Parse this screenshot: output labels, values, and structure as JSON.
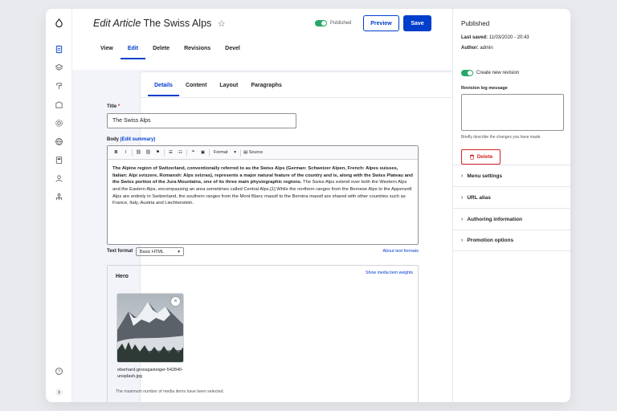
{
  "header": {
    "title_italic": "Edit Article",
    "title_name": "The Swiss Alps",
    "star_glyph": "☆",
    "published_label": "Published",
    "preview_label": "Preview",
    "save_label": "Save"
  },
  "primary_tabs": [
    {
      "label": "View"
    },
    {
      "label": "Edit"
    },
    {
      "label": "Delete"
    },
    {
      "label": "Revisions"
    },
    {
      "label": "Devel"
    }
  ],
  "secondary_tabs": [
    {
      "label": "Details"
    },
    {
      "label": "Content"
    },
    {
      "label": "Layout"
    },
    {
      "label": "Paragraphs"
    }
  ],
  "form": {
    "title_label": "Title",
    "title_required": "*",
    "title_value": "The Swiss Alps",
    "body_label": "Body",
    "body_link": "(Edit summary)",
    "toolbar": {
      "bold": "B",
      "italic": "I",
      "format_label": "Format",
      "source_label": "Source"
    },
    "body_bold_text": "The Alpine region of Switzerland, conventionally referred to as the Swiss Alps (German: Schweizer Alpen, French: Alpes suisses, Italian: Alpi svizzere, Romansh: Alps svizras), represents a major natural feature of the country and is, along with the Swiss Plateau and the Swiss portion of the Jura Mountains, one of its three main physiographic regions.",
    "body_normal_text": " The Swiss Alps extend over both the Western Alps and the Eastern Alps, encompassing an area sometimes called Central Alps.[1] While the northern ranges from the Bernese Alps to the Appenzell Alps are entirely in Switzerland, the southern ranges from the Mont Blanc massif to the Bernina massif are shared with other countries such as France, Italy, Austria and Liechtenstein.",
    "text_format_label": "Text format",
    "text_format_value": "Basic HTML",
    "about_link": "About text formats"
  },
  "hero": {
    "title": "Hero",
    "weights_link": "Show media item weights",
    "remove_glyph": "×",
    "file_name": "eberhard-grossgasteiger-542840-unsplash.jpg",
    "note": "The maximum number of media items have been selected."
  },
  "sidebar": {
    "status": "Published",
    "last_saved_label": "Last saved:",
    "last_saved_value": "11/03/2020 - 20:43",
    "author_label": "Author:",
    "author_value": "admin",
    "new_revision_label": "Create new revision",
    "revision_log_label": "Revision log message",
    "revision_help": "Briefly describe the changes you have made.",
    "delete_label": "Delete",
    "accordions": [
      {
        "label": "Menu settings"
      },
      {
        "label": "URL alias"
      },
      {
        "label": "Authoring information"
      },
      {
        "label": "Promotion options"
      }
    ]
  },
  "colors": {
    "accent": "#003ecc",
    "toggle_on": "#26a769",
    "danger": "#d72222"
  },
  "icons": [
    "drupal-logo-icon",
    "content-icon",
    "structure-icon",
    "appearance-icon",
    "extend-icon",
    "config-icon",
    "globe-icon",
    "reports-icon",
    "people-icon",
    "org-icon",
    "help-icon",
    "collapse-icon"
  ]
}
